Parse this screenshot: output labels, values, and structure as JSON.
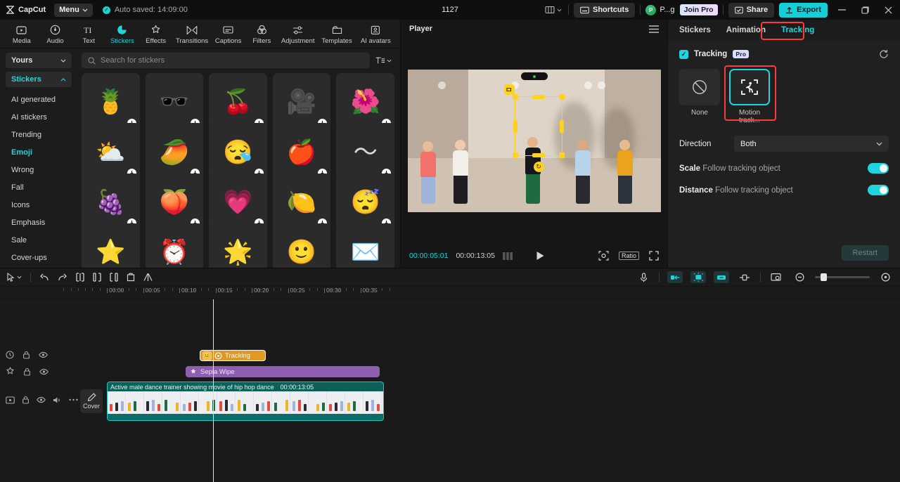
{
  "titlebar": {
    "brand": "CapCut",
    "menu_label": "Menu",
    "autosave": "Auto saved: 14:09:00",
    "project_title": "1127",
    "shortcuts_label": "Shortcuts",
    "account_name": "P...g",
    "account_initial": "P",
    "join_pro_label": "Join Pro",
    "share_label": "Share",
    "export_label": "Export",
    "minimize_icon": "minimize-icon",
    "maximize_icon": "maximize-icon",
    "close_icon": "close-icon",
    "accent": "#14cfd8"
  },
  "tooltabs": [
    {
      "label": "Media",
      "icon": "media-icon",
      "active": false
    },
    {
      "label": "Audio",
      "icon": "audio-icon",
      "active": false
    },
    {
      "label": "Text",
      "icon": "text-icon",
      "active": false
    },
    {
      "label": "Stickers",
      "icon": "stickers-icon",
      "active": true
    },
    {
      "label": "Effects",
      "icon": "effects-icon",
      "active": false
    },
    {
      "label": "Transitions",
      "icon": "transitions-icon",
      "active": false
    },
    {
      "label": "Captions",
      "icon": "captions-icon",
      "active": false
    },
    {
      "label": "Filters",
      "icon": "filters-icon",
      "active": false
    },
    {
      "label": "Adjustment",
      "icon": "adjustment-icon",
      "active": false
    },
    {
      "label": "Templates",
      "icon": "templates-icon",
      "active": false
    },
    {
      "label": "AI avatars",
      "icon": "ai-avatars-icon",
      "active": false
    }
  ],
  "categories": {
    "yours_label": "Yours",
    "stickers_label": "Stickers",
    "items": [
      {
        "label": "AI generated",
        "selected": false
      },
      {
        "label": "AI stickers",
        "selected": false
      },
      {
        "label": "Trending",
        "selected": false
      },
      {
        "label": "Emoji",
        "selected": true
      },
      {
        "label": "Wrong",
        "selected": false
      },
      {
        "label": "Fall",
        "selected": false
      },
      {
        "label": "Icons",
        "selected": false
      },
      {
        "label": "Emphasis",
        "selected": false
      },
      {
        "label": "Sale",
        "selected": false
      },
      {
        "label": "Cover-ups",
        "selected": false
      }
    ]
  },
  "search": {
    "placeholder": "Search for stickers",
    "value": "",
    "icon": "search-icon",
    "filter_icon": "sort-filter-icon"
  },
  "sticker_grid": [
    {
      "name": "pineapple-sticker",
      "glyph": "🍍"
    },
    {
      "name": "sunglasses-eyes-sticker",
      "glyph": "🕶️"
    },
    {
      "name": "cherry-sticker",
      "glyph": "🍒"
    },
    {
      "name": "movie-camera-sticker",
      "glyph": "🎥"
    },
    {
      "name": "red-flower-sticker",
      "glyph": "🌺"
    },
    {
      "name": "sun-behind-cloud-sticker",
      "glyph": "⛅"
    },
    {
      "name": "mango-sticker",
      "glyph": "🥭"
    },
    {
      "name": "sleepy-face-sticker",
      "glyph": "😪"
    },
    {
      "name": "apple-sticker",
      "glyph": "🍎"
    },
    {
      "name": "cyan-squiggle-sticker",
      "glyph": "〜"
    },
    {
      "name": "grapes-sticker",
      "glyph": "🍇"
    },
    {
      "name": "peach-sticker",
      "glyph": "🍑"
    },
    {
      "name": "pink-blob-sticker",
      "glyph": "💗"
    },
    {
      "name": "lemon-badge-sticker",
      "glyph": "🍋"
    },
    {
      "name": "sleeping-blue-sticker",
      "glyph": "😴"
    },
    {
      "name": "orange-star-sticker",
      "glyph": "⭐"
    },
    {
      "name": "alarm-clock-sticker",
      "glyph": "⏰"
    },
    {
      "name": "green-star-sticker",
      "glyph": "🌟"
    },
    {
      "name": "blue-face-sticker",
      "glyph": "🙂"
    },
    {
      "name": "paper-plane-sticker",
      "glyph": "✉️"
    }
  ],
  "player": {
    "title": "Player",
    "menu_icon": "hamburger-icon",
    "current_time": "00:00:05:01",
    "total_time": "00:00:13:05",
    "play_icon": "play-icon",
    "frames_icon": "frames-icon",
    "crop_icon": "crop-zoom-icon",
    "ratio_label": "Ratio",
    "fullscreen_icon": "fullscreen-icon"
  },
  "right_panel": {
    "tabs": [
      {
        "label": "Stickers",
        "active": false,
        "highlighted": false
      },
      {
        "label": "Animation",
        "active": false,
        "highlighted": false
      },
      {
        "label": "Tracking",
        "active": true,
        "highlighted": true
      }
    ],
    "section_label": "Tracking",
    "pro_badge": "Pro",
    "reset_icon": "reset-icon",
    "modes": [
      {
        "label": "None",
        "icon": "none-slash-icon",
        "selected": false,
        "highlighted": false
      },
      {
        "label": "Motion track...",
        "icon": "motion-track-icon",
        "selected": true,
        "highlighted": true
      }
    ],
    "direction": {
      "label": "Direction",
      "value": "Both",
      "chevron_icon": "chevron-down-icon"
    },
    "scale": {
      "label": "Scale",
      "sub": "Follow tracking object",
      "on": true
    },
    "distance": {
      "label": "Distance",
      "sub": "Follow tracking object",
      "on": true
    },
    "restart_label": "Restart",
    "highlight_color": "#fc3c3c",
    "accent": "#1fd4dd"
  },
  "timeline": {
    "tools_left": [
      {
        "name": "select-tool",
        "icon": "cursor-icon"
      },
      {
        "name": "undo-button",
        "icon": "undo-icon"
      },
      {
        "name": "redo-button",
        "icon": "redo-icon"
      },
      {
        "name": "split-button",
        "icon": "split-icon"
      },
      {
        "name": "trim-left-button",
        "icon": "trim-left-icon"
      },
      {
        "name": "trim-right-button",
        "icon": "trim-right-icon"
      },
      {
        "name": "delete-button",
        "icon": "trash-icon"
      },
      {
        "name": "mirror-button",
        "icon": "mirror-icon"
      }
    ],
    "tools_right": [
      {
        "name": "record-voiceover-button",
        "icon": "microphone-icon",
        "on": false
      },
      {
        "name": "auto-cut-button",
        "icon": "clip-in-icon",
        "on": true
      },
      {
        "name": "snap-button",
        "icon": "magnet-snap-icon",
        "on": true
      },
      {
        "name": "link-button",
        "icon": "clip-out-icon",
        "on": true
      },
      {
        "name": "keyframe-button",
        "icon": "keyframe-icon",
        "on": false
      },
      {
        "name": "fit-timeline-button",
        "icon": "fit-screen-icon",
        "on": false
      },
      {
        "name": "zoom-out-button",
        "icon": "zoom-out-icon",
        "on": false
      },
      {
        "name": "zoom-in-button",
        "icon": "zoom-in-icon",
        "on": false
      }
    ],
    "ruler_ticks": [
      "00:00",
      "00:05",
      "00:10",
      "00:15",
      "00:20",
      "00:25",
      "00:30",
      "00:35"
    ],
    "playhead_time": "00:05",
    "cover_label": "Cover",
    "clips": {
      "sticker": {
        "label": "Tracking",
        "badge_icon": "emoji-chip-icon",
        "target_icon": "target-icon"
      },
      "effect": {
        "label": "Sepia Wipe",
        "icon": "effect-icon"
      },
      "video": {
        "label": "Active male dance trainer showing movie of hip hop dance",
        "duration": "00:00:13:05"
      }
    },
    "track_controls": [
      {
        "name": "sticker-track",
        "icons": [
          "clock-icon",
          "lock-icon",
          "eye-icon"
        ]
      },
      {
        "name": "effect-track",
        "icons": [
          "effect-icon",
          "lock-icon",
          "eye-icon"
        ]
      },
      {
        "name": "video-track",
        "icons": [
          "video-icon",
          "lock-icon",
          "eye-icon",
          "volume-icon",
          "more-icon"
        ]
      }
    ]
  }
}
